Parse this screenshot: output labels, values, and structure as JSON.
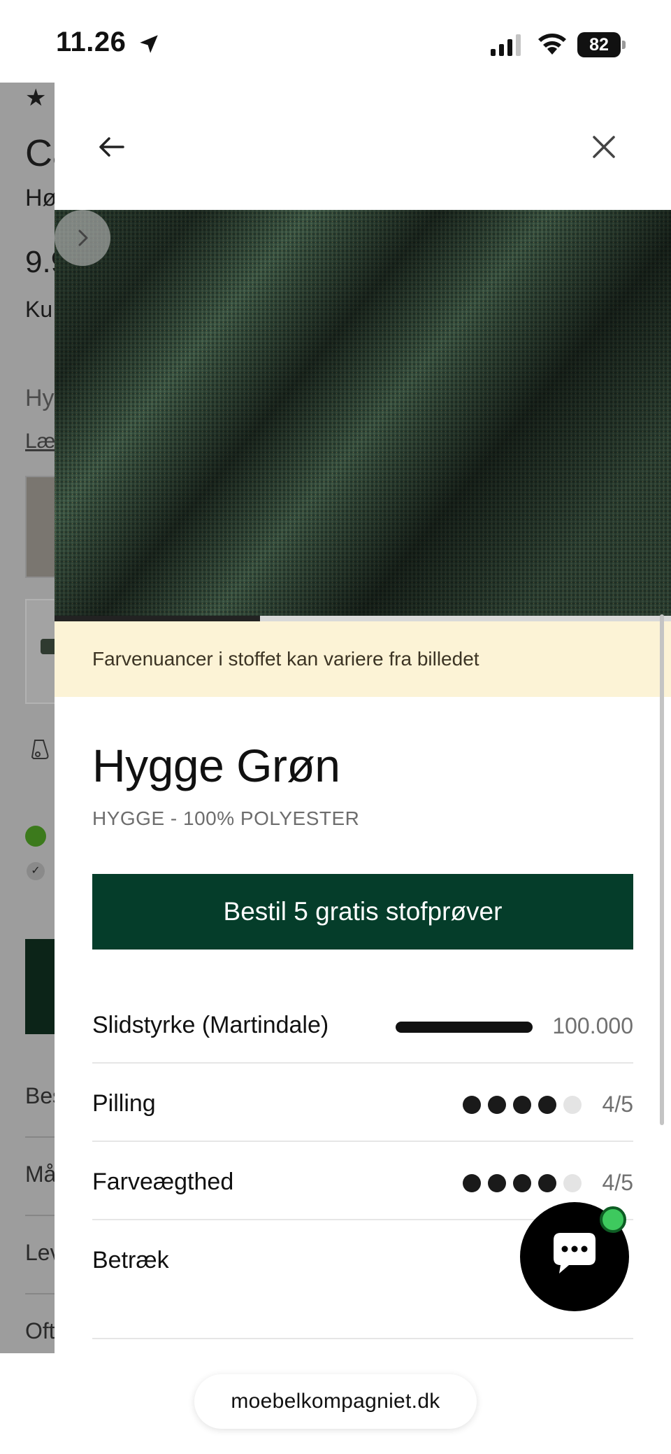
{
  "status_bar": {
    "time": "11.26",
    "battery": "82",
    "icons": [
      "location-arrow-icon",
      "cellular-signal-icon",
      "wifi-icon",
      "battery-icon"
    ]
  },
  "background_page": {
    "rating": "★ ★",
    "product_name": "Ca",
    "description": "Hø",
    "price": "9.9",
    "price_note": "Ku",
    "fabric_label": "Hy",
    "read_more": "Læ",
    "rows": [
      "Bes",
      "Må",
      "Lev",
      "Oft"
    ]
  },
  "drawer": {
    "back_icon": "arrow-left-icon",
    "close_icon": "close-icon",
    "next_icon": "chevron-right-icon",
    "image_progress": 0.333,
    "notice": "Farvenuancer i stoffet kan variere fra billedet",
    "fabric_name": "Hygge Grøn",
    "fabric_subtitle": "HYGGE - 100% POLYESTER",
    "order_button": "Bestil 5 gratis stofprøver",
    "specs": [
      {
        "label": "Slidstyrke (Martindale)",
        "value": "100.000"
      },
      {
        "label": "Pilling",
        "value": "4/5",
        "rating": 4,
        "max": 5
      },
      {
        "label": "Farveægthed",
        "value": "4/5",
        "rating": 4,
        "max": 5
      },
      {
        "label": "Betræk",
        "value": ""
      }
    ]
  },
  "chat": {
    "icon": "chat-bubble-icon",
    "status_color": "#3ec95e"
  },
  "browser": {
    "url": "moebelkompagniet.dk"
  },
  "colors": {
    "primary_green": "#053d2a",
    "notice_background": "#fcf3d6",
    "fabric_green": "#2f4a38"
  }
}
